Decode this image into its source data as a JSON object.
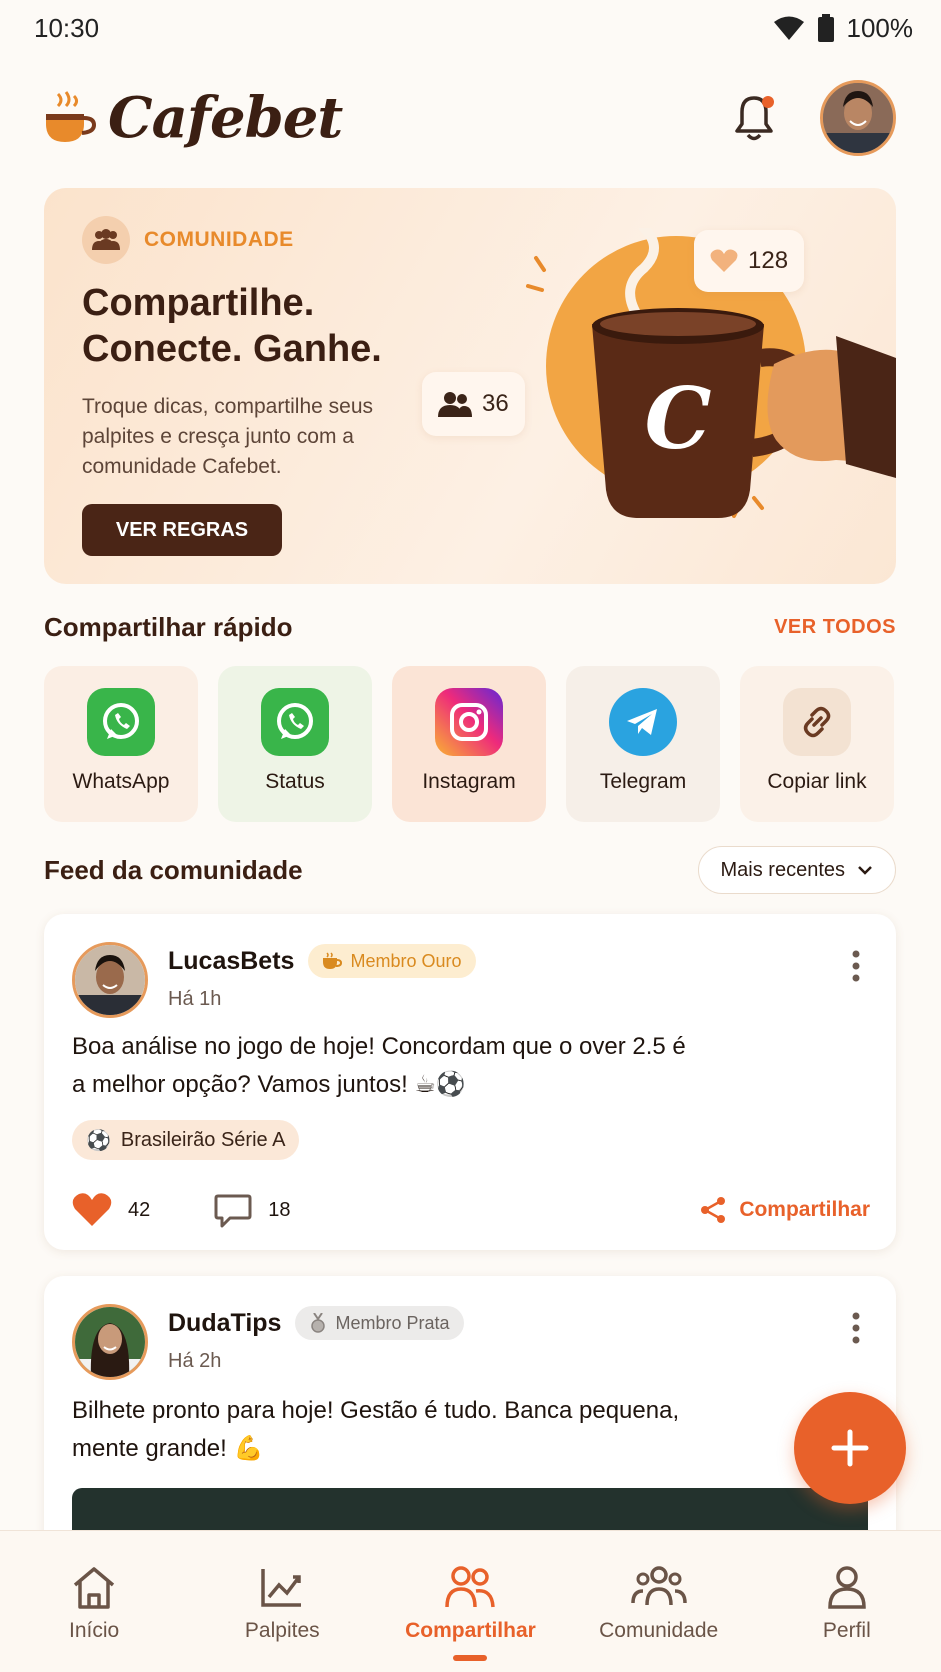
{
  "status_bar": {
    "time": "10:30",
    "battery": "100%"
  },
  "header": {
    "brand": "Cafebet"
  },
  "hero": {
    "tag": "COMUNIDADE",
    "title_line1": "Compartilhe.",
    "title_line2": "Conecte. Ganhe.",
    "description": "Troque dicas, compartilhe seus palpites e cresça junto com a comunidade Cafebet.",
    "button": "VER REGRAS",
    "likes_count": "128",
    "members_count": "36",
    "mug_letter": "C"
  },
  "quick_share": {
    "title": "Compartilhar rápido",
    "see_all": "VER TODOS",
    "items": [
      {
        "label": "WhatsApp",
        "icon": "whatsapp-icon"
      },
      {
        "label": "Status",
        "icon": "whatsapp-status-icon"
      },
      {
        "label": "Instagram",
        "icon": "instagram-icon"
      },
      {
        "label": "Telegram",
        "icon": "telegram-icon"
      },
      {
        "label": "Copiar link",
        "icon": "link-icon"
      }
    ]
  },
  "feed": {
    "title": "Feed da comunidade",
    "sort": "Mais recentes",
    "posts": [
      {
        "user": "LucasBets",
        "badge": "Membro Ouro",
        "time": "Há 1h",
        "text_line1": "Boa análise no jogo de hoje! Concordam que o over 2.5 é",
        "text_line2": "a melhor opção? Vamos juntos! ☕⚽",
        "topic": "Brasileirão Série A",
        "likes": "42",
        "comments": "18",
        "share": "Compartilhar"
      },
      {
        "user": "DudaTips",
        "badge": "Membro Prata",
        "time": "Há 2h",
        "text_line1": "Bilhete pronto para hoje! Gestão é tudo. Banca pequena,",
        "text_line2": "mente grande! 💪"
      }
    ]
  },
  "bottom_nav": {
    "items": [
      {
        "label": "Início"
      },
      {
        "label": "Palpites"
      },
      {
        "label": "Compartilhar"
      },
      {
        "label": "Comunidade"
      },
      {
        "label": "Perfil"
      }
    ],
    "active": "Compartilhar"
  },
  "colors": {
    "accent": "#e8612a",
    "brand_dark": "#3b1f13",
    "gold": "#e88a2b"
  }
}
